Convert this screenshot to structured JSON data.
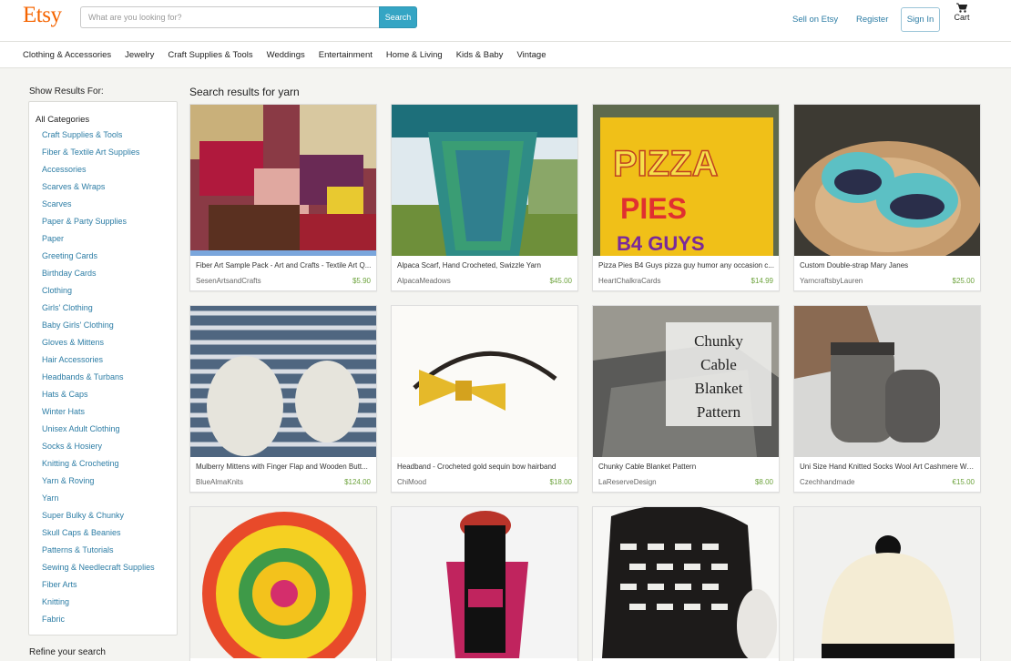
{
  "header": {
    "logo": "Etsy",
    "search_placeholder": "What are you looking for?",
    "search_button": "Search",
    "sell_link": "Sell on Etsy",
    "register_link": "Register",
    "signin_button": "Sign In",
    "cart_label": "Cart",
    "cart_icon": "shopping-cart-icon"
  },
  "categories_nav": [
    "Clothing & Accessories",
    "Jewelry",
    "Craft Supplies & Tools",
    "Weddings",
    "Entertainment",
    "Home & Living",
    "Kids & Baby",
    "Vintage"
  ],
  "sidebar": {
    "title": "Show Results For:",
    "all_label": "All Categories",
    "items": [
      "Craft Supplies & Tools",
      "Fiber & Textile Art Supplies",
      "Accessories",
      "Scarves & Wraps",
      "Scarves",
      "Paper & Party Supplies",
      "Paper",
      "Greeting Cards",
      "Birthday Cards",
      "Clothing",
      "Girls' Clothing",
      "Baby Girls' Clothing",
      "Gloves & Mittens",
      "Hair Accessories",
      "Headbands & Turbans",
      "Hats & Caps",
      "Winter Hats",
      "Unisex Adult Clothing",
      "Socks & Hosiery",
      "Knitting & Crocheting",
      "Yarn & Roving",
      "Yarn",
      "Super Bulky & Chunky",
      "Skull Caps & Beanies",
      "Patterns & Tutorials",
      "Sewing & Needlecraft Supplies",
      "Fiber Arts",
      "Knitting",
      "Fabric"
    ],
    "refine_title": "Refine your search"
  },
  "results": {
    "title": "Search results for yarn",
    "listings": [
      {
        "title": "Fiber Art Sample Pack - Art and Crafts - Textile Art Q...",
        "shop": "SesenArtsandCrafts",
        "price": "$5.90"
      },
      {
        "title": "Alpaca Scarf, Hand Crocheted, Swizzle Yarn",
        "shop": "AlpacaMeadows",
        "price": "$45.00"
      },
      {
        "title": "Pizza Pies B4 Guys pizza guy humor any occasion c...",
        "shop": "HeartChalkraCards",
        "price": "$14.99"
      },
      {
        "title": "Custom Double-strap Mary Janes",
        "shop": "YarncraftsbyLauren",
        "price": "$25.00"
      },
      {
        "title": "Mulberry Mittens with Finger Flap and Wooden Butt...",
        "shop": "BlueAlmaKnits",
        "price": "$124.00"
      },
      {
        "title": "Headband - Crocheted gold sequin bow hairband",
        "shop": "ChiMood",
        "price": "$18.00"
      },
      {
        "title": "Chunky Cable Blanket Pattern",
        "shop": "LaReserveDesign",
        "price": "$8.00"
      },
      {
        "title": "Uni Size Hand Knitted Socks Wool Art Cashmere Wa...",
        "shop": "Czechhandmade",
        "price": "€15.00"
      },
      {
        "title": "",
        "shop": "",
        "price": ""
      },
      {
        "title": "",
        "shop": "",
        "price": ""
      },
      {
        "title": "",
        "shop": "",
        "price": ""
      },
      {
        "title": "",
        "shop": "",
        "price": ""
      }
    ],
    "image_texts": {
      "pizza_line1": "PIZZA",
      "pizza_line2": "PIES",
      "pizza_line3": "B4 GUYS",
      "blanket_lines": [
        "Chunky",
        "Cable",
        "Blanket",
        "Pattern"
      ]
    }
  },
  "colors": {
    "brand": "#f56400",
    "link": "#2d7da5",
    "search_button": "#35a5c4",
    "price": "#6da33d"
  }
}
